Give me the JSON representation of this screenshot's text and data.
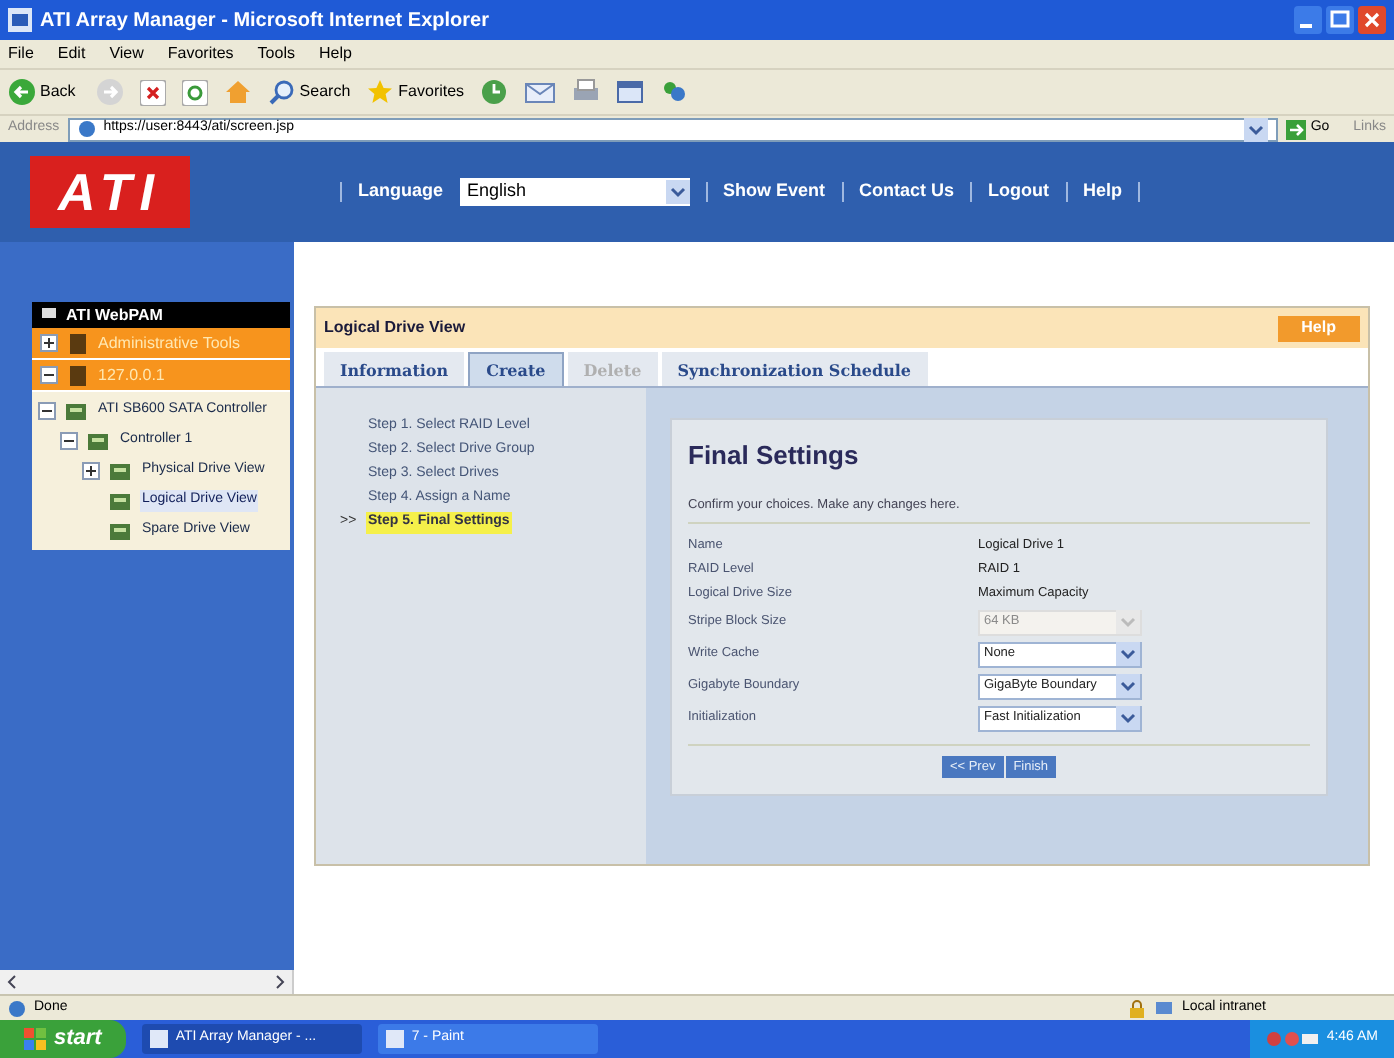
{
  "window": {
    "title": "ATI Array Manager - Microsoft Internet Explorer"
  },
  "menu": [
    "File",
    "Edit",
    "View",
    "Favorites",
    "Tools",
    "Help"
  ],
  "toolbar": [
    {
      "kind": "back",
      "label": "Back"
    },
    {
      "kind": "search",
      "label": "Search"
    },
    {
      "kind": "favorites",
      "label": "Favorites"
    }
  ],
  "address": {
    "label": "Address",
    "value": "https://user:8443/ati/screen.jsp",
    "go": "Go",
    "links": "Links"
  },
  "header": {
    "logo": "ATI",
    "language_label": "Language",
    "language": "English",
    "links": [
      "Show Event",
      "Contact Us",
      "Logout",
      "Help"
    ]
  },
  "sidebar": {
    "title": "ATI WebPAM",
    "items": [
      {
        "label": "Administrative Tools",
        "expanded": false
      },
      {
        "label": "127.0.0.1",
        "expanded": true,
        "children": [
          {
            "label": "ATI SB600 SATA Controller",
            "expanded": true,
            "selected": false,
            "children": [
              {
                "label": "Controller 1",
                "expanded": true,
                "selected": false,
                "children": [
                  {
                    "label": "Physical Drive View",
                    "expanded": false,
                    "selected": false
                  },
                  {
                    "label": "Logical Drive View",
                    "selected": true
                  },
                  {
                    "label": "Spare Drive View",
                    "selected": false
                  }
                ]
              }
            ]
          }
        ]
      }
    ]
  },
  "panel": {
    "title": "Logical Drive View",
    "help": "Help",
    "tabs": [
      {
        "label": "Information",
        "selected": false,
        "disabled": false
      },
      {
        "label": "Create",
        "selected": true,
        "disabled": false
      },
      {
        "label": "Delete",
        "selected": false,
        "disabled": true
      },
      {
        "label": "Synchronization Schedule",
        "selected": false,
        "disabled": false
      }
    ],
    "steps": [
      {
        "label": "Step 1. Select RAID Level",
        "selected": false
      },
      {
        "label": "Step 2. Select Drive Group",
        "selected": false
      },
      {
        "label": "Step 3. Select Drives",
        "selected": false
      },
      {
        "label": "Step 4. Assign a Name",
        "selected": false
      },
      {
        "label": "Step 5. Final Settings",
        "selected": true
      }
    ],
    "current_marker": ">>",
    "heading": "Final Settings",
    "description": "Confirm your choices. Make any changes here.",
    "rows": [
      {
        "kind": "text",
        "label": "Name",
        "value": "Logical Drive 1"
      },
      {
        "kind": "text",
        "label": "RAID Level",
        "value": "RAID 1"
      },
      {
        "kind": "text",
        "label": "Logical Drive Size",
        "value": "Maximum Capacity"
      },
      {
        "kind": "select",
        "label": "Stripe Block Size",
        "value": "64 KB",
        "disabled": true
      },
      {
        "kind": "select",
        "label": "Write Cache",
        "value": "None",
        "disabled": false
      },
      {
        "kind": "select",
        "label": "Gigabyte Boundary",
        "value": "GigaByte Boundary",
        "disabled": false
      },
      {
        "kind": "select",
        "label": "Initialization",
        "value": "Fast Initialization",
        "disabled": false
      }
    ],
    "buttons": [
      "<< Prev",
      "Finish"
    ]
  },
  "status_bar": {
    "text": "Done",
    "zone": "Local intranet"
  },
  "taskbar": {
    "start": "start",
    "tasks": [
      {
        "label": "ATI Array Manager - ...",
        "selected": true
      },
      {
        "label": "7 - Paint",
        "selected": false
      }
    ],
    "clock": "4:46 AM"
  }
}
